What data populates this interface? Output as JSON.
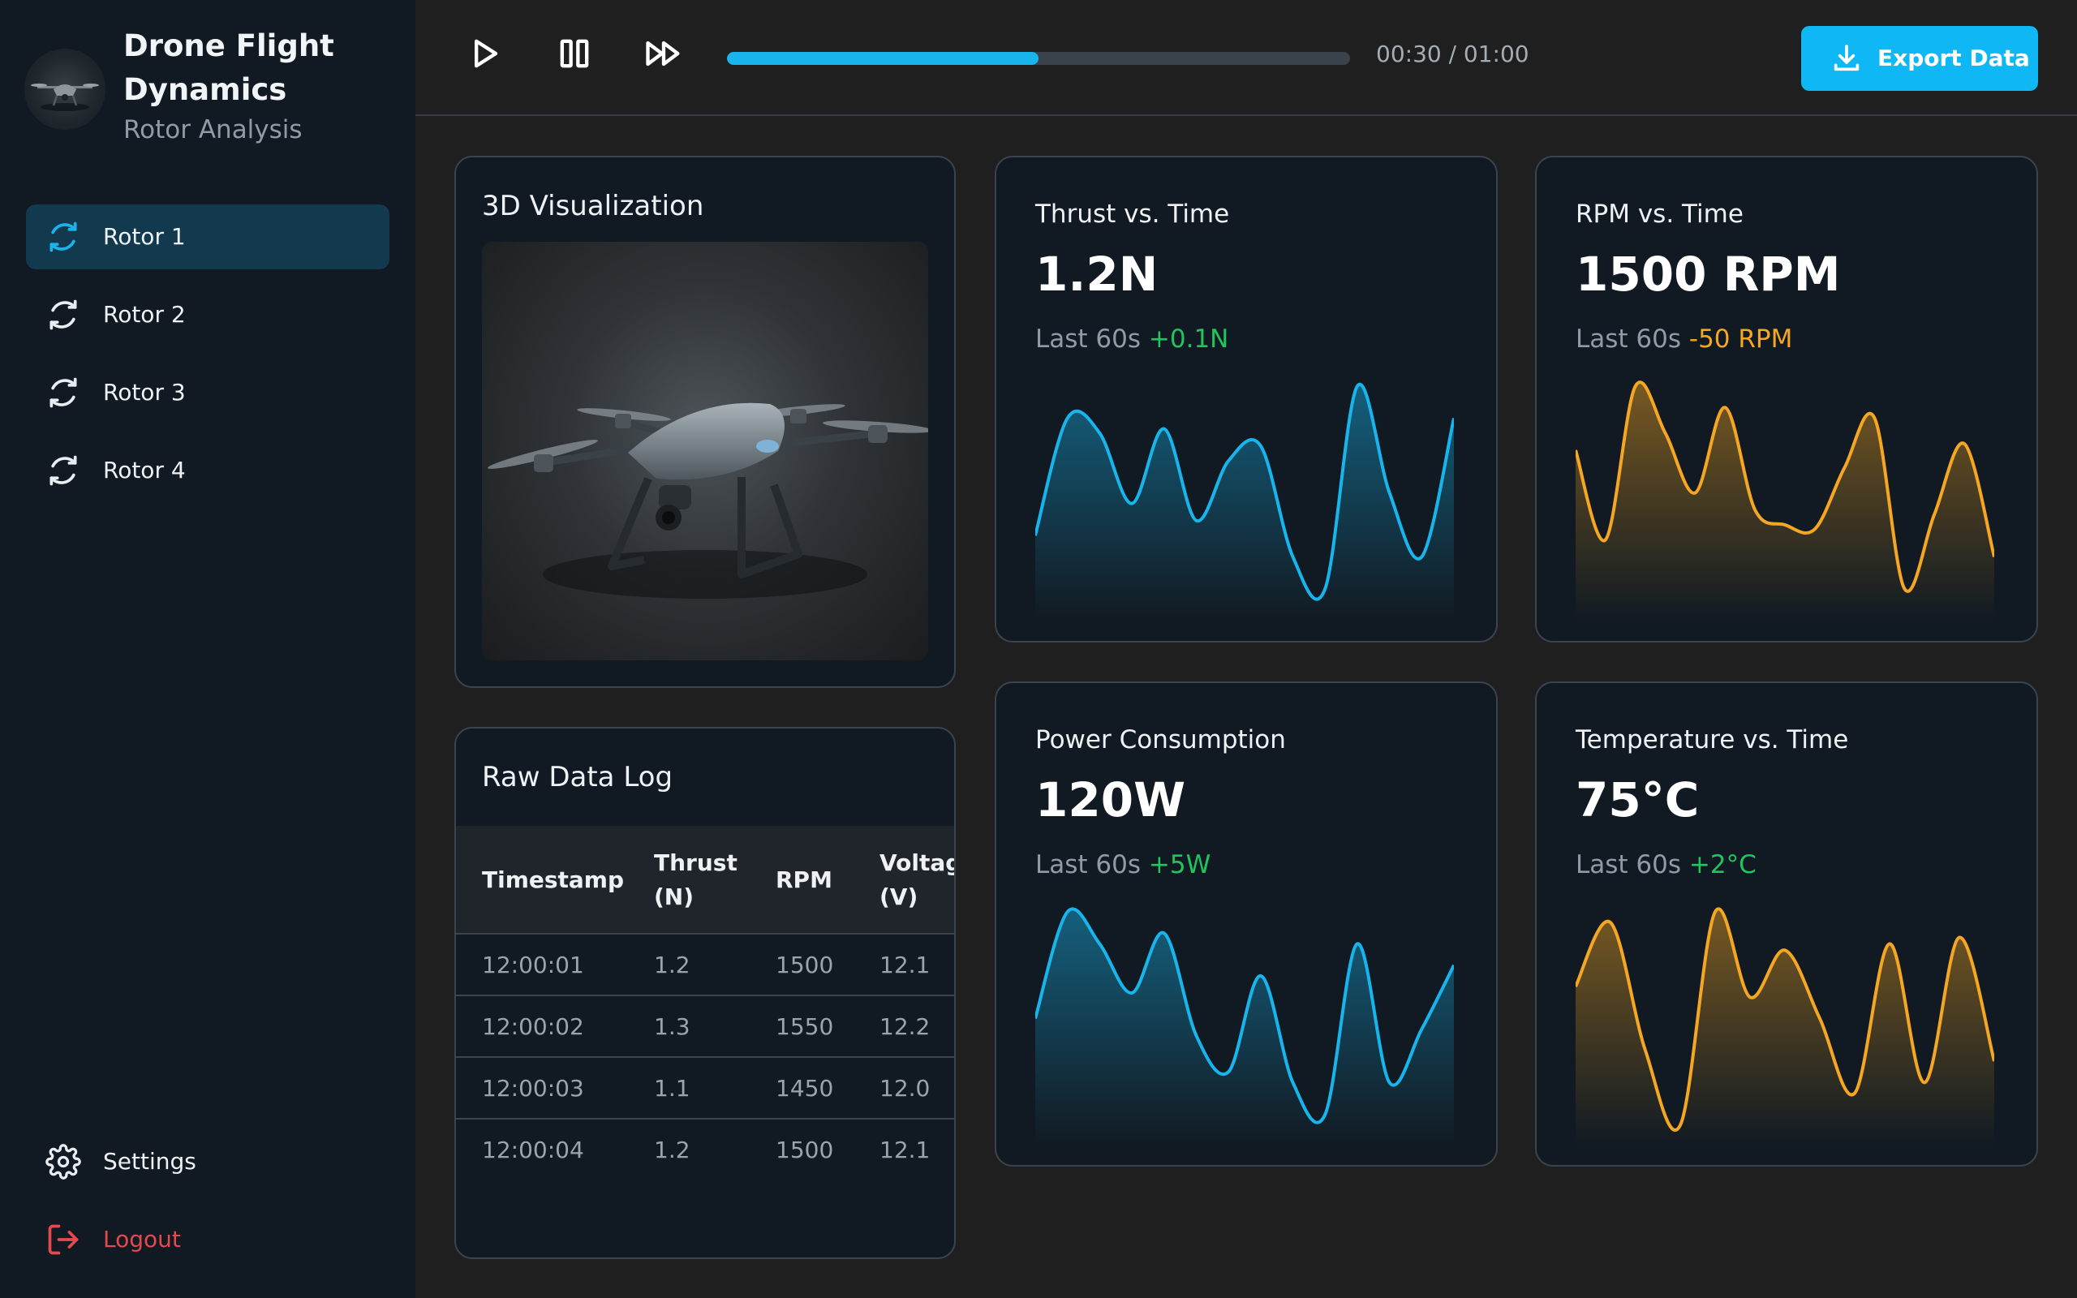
{
  "sidebar": {
    "brand_title": "Drone Flight Dynamics",
    "brand_subtitle": "Rotor Analysis",
    "items": [
      {
        "label": "Rotor 1",
        "icon": "refresh-icon",
        "active": true
      },
      {
        "label": "Rotor 2",
        "icon": "refresh-icon",
        "active": false
      },
      {
        "label": "Rotor 3",
        "icon": "refresh-icon",
        "active": false
      },
      {
        "label": "Rotor 4",
        "icon": "refresh-icon",
        "active": false
      }
    ],
    "settings_label": "Settings",
    "logout_label": "Logout"
  },
  "topbar": {
    "play_icon": "play-icon",
    "pause_icon": "pause-icon",
    "fast_forward_icon": "fast-forward-icon",
    "progress": 0.5,
    "time_readout": "00:30 / 01:00",
    "export_label": "Export Data",
    "export_icon": "download-icon"
  },
  "viz": {
    "title": "3D Visualization"
  },
  "log": {
    "title": "Raw Data Log",
    "headers": [
      "Timestamp",
      "Thrust (N)",
      "RPM",
      "Voltag (V)"
    ],
    "rows": [
      [
        "12:00:01",
        "1.2",
        "1500",
        "12.1"
      ],
      [
        "12:00:02",
        "1.3",
        "1550",
        "12.2"
      ],
      [
        "12:00:03",
        "1.1",
        "1450",
        "12.0"
      ],
      [
        "12:00:04",
        "1.2",
        "1500",
        "12.1"
      ]
    ]
  },
  "metrics": [
    {
      "label": "Thrust vs. Time",
      "value": "1.2N",
      "delta_prefix": "Last 60s",
      "delta": "+0.1N",
      "trend": "up",
      "color": "#18b4ec",
      "series": [
        0.3,
        0.85,
        0.78,
        0.45,
        0.8,
        0.37,
        0.65,
        0.72,
        0.2,
        0.05,
        1.0,
        0.5,
        0.2,
        0.85
      ]
    },
    {
      "label": "RPM vs. Time",
      "value": "1500 RPM",
      "delta_prefix": "Last 60s",
      "delta": "-50 RPM",
      "trend": "down",
      "color": "#f5a623",
      "series": [
        0.7,
        0.28,
        1.0,
        0.78,
        0.5,
        0.9,
        0.42,
        0.35,
        0.33,
        0.62,
        0.85,
        0.05,
        0.4,
        0.73,
        0.2
      ]
    },
    {
      "label": "Power Consumption",
      "value": "120W",
      "delta_prefix": "Last 60s",
      "delta": "+5W",
      "trend": "up",
      "color": "#18b4ec",
      "series": [
        0.5,
        1.0,
        0.85,
        0.62,
        0.9,
        0.42,
        0.25,
        0.7,
        0.2,
        0.05,
        0.85,
        0.2,
        0.45,
        0.75
      ]
    },
    {
      "label": "Temperature vs. Time",
      "value": "75°C",
      "delta_prefix": "Last 60s",
      "delta": "+2°C",
      "trend": "up",
      "color": "#f5a623",
      "series": [
        0.65,
        0.95,
        0.35,
        0.0,
        1.0,
        0.6,
        0.82,
        0.5,
        0.15,
        0.85,
        0.2,
        0.88,
        0.3
      ]
    }
  ]
}
